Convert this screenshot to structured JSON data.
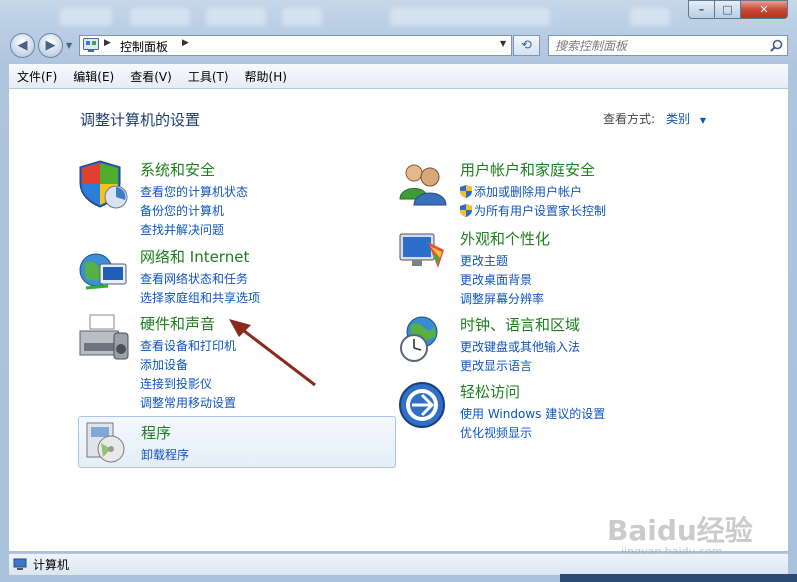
{
  "window": {
    "caption_buttons": {
      "minimize": "–",
      "maximize": "□",
      "close": "✕"
    },
    "colors": {
      "frame": "#b9cee4",
      "link": "#0f55bd",
      "category": "#1d7f1d",
      "close": "#c74b36"
    }
  },
  "nav": {
    "back_icon": "back-arrow-icon",
    "forward_icon": "forward-arrow-icon",
    "breadcrumb": "控制面板",
    "search_placeholder": "搜索控制面板"
  },
  "menubar": {
    "items": [
      "文件(F)",
      "编辑(E)",
      "查看(V)",
      "工具(T)",
      "帮助(H)"
    ]
  },
  "content": {
    "title": "调整计算机的设置",
    "view_by_label": "查看方式:",
    "view_by_value": "类别",
    "categories": {
      "system_security": {
        "title": "系统和安全",
        "links": [
          "查看您的计算机状态",
          "备份您的计算机",
          "查找并解决问题"
        ]
      },
      "network": {
        "title": "网络和 Internet",
        "links": [
          "查看网络状态和任务",
          "选择家庭组和共享选项"
        ]
      },
      "hardware": {
        "title": "硬件和声音",
        "links": [
          "查看设备和打印机",
          "添加设备",
          "连接到投影仪",
          "调整常用移动设置"
        ]
      },
      "programs": {
        "title": "程序",
        "links": [
          "卸载程序"
        ]
      },
      "user_accounts": {
        "title": "用户帐户和家庭安全",
        "links": [
          "添加或删除用户帐户",
          "为所有用户设置家长控制"
        ]
      },
      "appearance": {
        "title": "外观和个性化",
        "links": [
          "更改主题",
          "更改桌面背景",
          "调整屏幕分辨率"
        ]
      },
      "clock": {
        "title": "时钟、语言和区域",
        "links": [
          "更改键盘或其他输入法",
          "更改显示语言"
        ]
      },
      "ease": {
        "title": "轻松访问",
        "links": [
          "使用 Windows 建议的设置",
          "优化视频显示"
        ]
      }
    }
  },
  "status": {
    "label": "计算机"
  },
  "watermark": {
    "text": "Baidu经验",
    "sub": "jingyan.baidu.com"
  }
}
